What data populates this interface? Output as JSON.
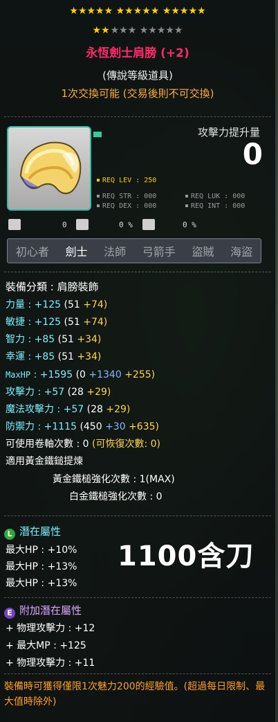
{
  "stars": {
    "row1": "★★★★★ ★★★★★ ★★★★★",
    "row2_gold": "★★",
    "row2_gray": "★★★ ★★★★★"
  },
  "item": {
    "name": "永恆劍士肩膀 (+2)",
    "grade": "(傳說等級道具)",
    "trade_note": "1次交換可能 (交易後則不可交換)",
    "attack_label": "攻擊力提升量",
    "attack_value": "0",
    "req_lev": "REQ LEV : 250",
    "req_str": "REQ STR : 000",
    "req_dex": "REQ DEX : 000",
    "req_luk": "REQ LUK : 000",
    "req_int": "REQ INT : 000",
    "small1": "0",
    "small2": "0 %",
    "small3": "0 %"
  },
  "jobs": [
    "初心者",
    "劍士",
    "法師",
    "弓箭手",
    "盜賊",
    "海盜"
  ],
  "stats": {
    "category": "裝備分類 : 肩膀裝飾",
    "str": {
      "label": "力量",
      "total": "+125",
      "base": "(51",
      "bonus": "+74)"
    },
    "dex": {
      "label": "敏捷",
      "total": "+125",
      "base": "(51",
      "bonus": "+74)"
    },
    "int": {
      "label": "智力",
      "total": "+85",
      "base": "(51",
      "bonus": "+34)"
    },
    "luk": {
      "label": "幸運",
      "total": "+85",
      "base": "(51",
      "bonus": "+34)"
    },
    "maxhp": {
      "label": "MaxHP",
      "total": "+1595",
      "base": "(0",
      "flame": "+1340",
      "bonus": "+255)"
    },
    "att": {
      "label": "攻擊力",
      "total": "+57",
      "base": "(28",
      "bonus": "+29)"
    },
    "matt": {
      "label": "魔法攻擊力",
      "total": "+57",
      "base": "(28",
      "bonus": "+29)"
    },
    "def": {
      "label": "防禦力",
      "total": "+1115",
      "base": "(450",
      "flame": "+30",
      "bonus": "+635)"
    },
    "upgrades": "可使用卷軸次數 : 0",
    "upgrades_restore": "(可恢復次數: 0)",
    "hammer": "適用黃金鐵鎚提煉",
    "golden": "黃金鐵槌強化次數 : 1(MAX)",
    "platinum": "白金鐵槌強化次數 : 0"
  },
  "potential": {
    "badge": "L",
    "title": "潛在屬性",
    "lines": [
      "最大HP : +10%",
      "最大HP : +13%",
      "最大HP : +13%"
    ]
  },
  "overlay_text": "1100含刀",
  "additional": {
    "badge": "E",
    "title": "附加潛在屬性",
    "lines": [
      "+ 物理攻擊力 : +12",
      "+ 最大MP : +125",
      "+ 物理攻擊力 : +11"
    ]
  },
  "footer": "裝備時可獲得僅限1次魅力200的經驗值。(超過每日限制、最大值時除外)",
  "colors": {
    "title": "#ff2a6a",
    "trade": "#ffae3d",
    "flame": "#8bb4ff",
    "bonus": "#ffd54a",
    "potential": "#7af0ff",
    "legendary_badge": "#2eaa3a",
    "epic_badge": "#7a3fc8"
  }
}
